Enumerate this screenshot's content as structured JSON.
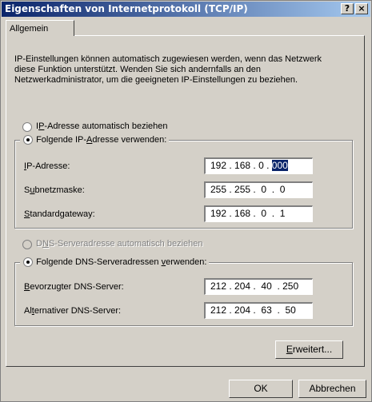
{
  "window": {
    "title": "Eigenschaften von Internetprotokoll (TCP/IP)",
    "help_glyph": "?",
    "close_glyph": "×"
  },
  "tabs": [
    {
      "label": "Allgemein",
      "active": true
    }
  ],
  "description": "IP-Einstellungen können automatisch zugewiesen werden, wenn das Netzwerk diese Funktion unterstützt. Wenden Sie sich andernfalls an den Netzwerkadministrator, um die geeigneten IP-Einstellungen zu beziehen.",
  "ip_mode": {
    "auto": {
      "pre": "I",
      "acc": "P",
      "post": "-Adresse automatisch beziehen",
      "selected": false
    },
    "manual": {
      "pre": "Folgende IP-",
      "acc": "A",
      "post": "dresse verwenden:",
      "selected": true
    }
  },
  "ip_fields": {
    "ip": {
      "pre": "",
      "acc": "I",
      "post": "P-Adresse:",
      "octets": [
        "192",
        "168",
        "0",
        "000"
      ],
      "selected_octet": 3
    },
    "subnet": {
      "pre": "S",
      "acc": "u",
      "post": "bnetzmaske:",
      "octets": [
        "255",
        "255",
        "0",
        "0"
      ]
    },
    "gateway": {
      "pre": "",
      "acc": "S",
      "post": "tandardgateway:",
      "octets": [
        "192",
        "168",
        "0",
        "1"
      ]
    }
  },
  "dns_mode": {
    "auto": {
      "pre": "D",
      "acc": "N",
      "post": "S-Serveradresse automatisch beziehen",
      "selected": false,
      "disabled": true
    },
    "manual": {
      "pre": "Folgende DNS-Serveradressen ",
      "acc": "v",
      "post": "erwenden:",
      "selected": true
    }
  },
  "dns_fields": {
    "preferred": {
      "pre": "",
      "acc": "B",
      "post": "evorzugter DNS-Server:",
      "octets": [
        "212",
        "204",
        "40",
        "250"
      ]
    },
    "alternate": {
      "pre": "Al",
      "acc": "t",
      "post": "ernativer DNS-Server:",
      "octets": [
        "212",
        "204",
        "63",
        "50"
      ]
    }
  },
  "buttons": {
    "advanced": {
      "pre": "",
      "acc": "E",
      "post": "rweitert..."
    },
    "ok": "OK",
    "cancel": "Abbrechen"
  },
  "colors": {
    "titlebar_start": "#0a246a",
    "titlebar_end": "#a6caf0",
    "face": "#d4d0c8",
    "selection": "#0a246a"
  }
}
